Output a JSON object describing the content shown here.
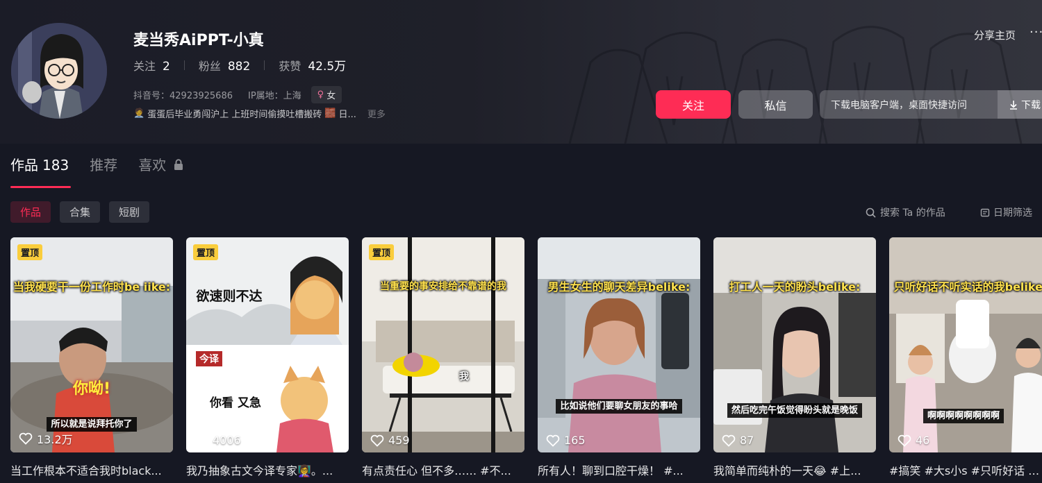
{
  "profile": {
    "nickname": "麦当秀AiPPT-小真",
    "following_label": "关注",
    "following_count": "2",
    "followers_label": "粉丝",
    "followers_count": "882",
    "likes_label": "获赞",
    "likes_count": "42.5万",
    "douyin_id": "抖音号：42923925686",
    "ip_location": "IP属地：上海",
    "gender": "女",
    "bio": "蛋蛋后毕业勇闯沪上 上班时间偷摸吐槽搬砖",
    "bio_tail": "日...",
    "bio_more": "更多"
  },
  "header_actions": {
    "share": "分享主页",
    "more": "···",
    "follow": "关注",
    "message": "私信",
    "download_prompt": "下载电脑客户端，桌面快捷访问",
    "download_button": "下载"
  },
  "tabs": [
    {
      "label": "作品",
      "count": "183",
      "active": true
    },
    {
      "label": "推荐"
    },
    {
      "label": "喜欢",
      "locked": true
    }
  ],
  "subtabs": [
    "作品",
    "合集",
    "短剧"
  ],
  "toolbar": {
    "search": "搜索 Ta 的作品",
    "date_filter": "日期筛选"
  },
  "videos": [
    {
      "pinned": "置顶",
      "caption_top": "当我硬要干一份工作时be iike:",
      "caption_bottom": "所以就是说拜托你了",
      "sticker": "你呦!",
      "likes": "13.2万",
      "title": "当工作根本不适合我时black..."
    },
    {
      "pinned": "置顶",
      "caption_top": "欲速则不达",
      "caption_bottom": "你看 又急",
      "badge": "今译",
      "likes": "4006",
      "title": "我乃抽象古文今译专家👩‍🏫。..."
    },
    {
      "pinned": "置顶",
      "caption_top": "当重要的事安排给不靠谱的我",
      "caption_bottom": "我",
      "likes": "459",
      "title": "有点责任心 但不多……  #不..."
    },
    {
      "caption_top": "男生女生的聊天差异belike:",
      "caption_bottom": "比如说他们要聊女朋友的事哈",
      "likes": "165",
      "title": "所有人！聊到口腔干燥！ #..."
    },
    {
      "caption_top": "打工人一天的盼头belike:",
      "caption_bottom": "然后吃完午饭觉得盼头就是晚饭",
      "likes": "87",
      "title": "我简单而纯朴的一天😂 #上..."
    },
    {
      "caption_top": "只听好话不听实话的我belike:",
      "caption_bottom": "啊啊啊啊啊啊啊啊",
      "likes": "46",
      "title": "#搞笑 #大s小s #只听好话 #..."
    }
  ]
}
